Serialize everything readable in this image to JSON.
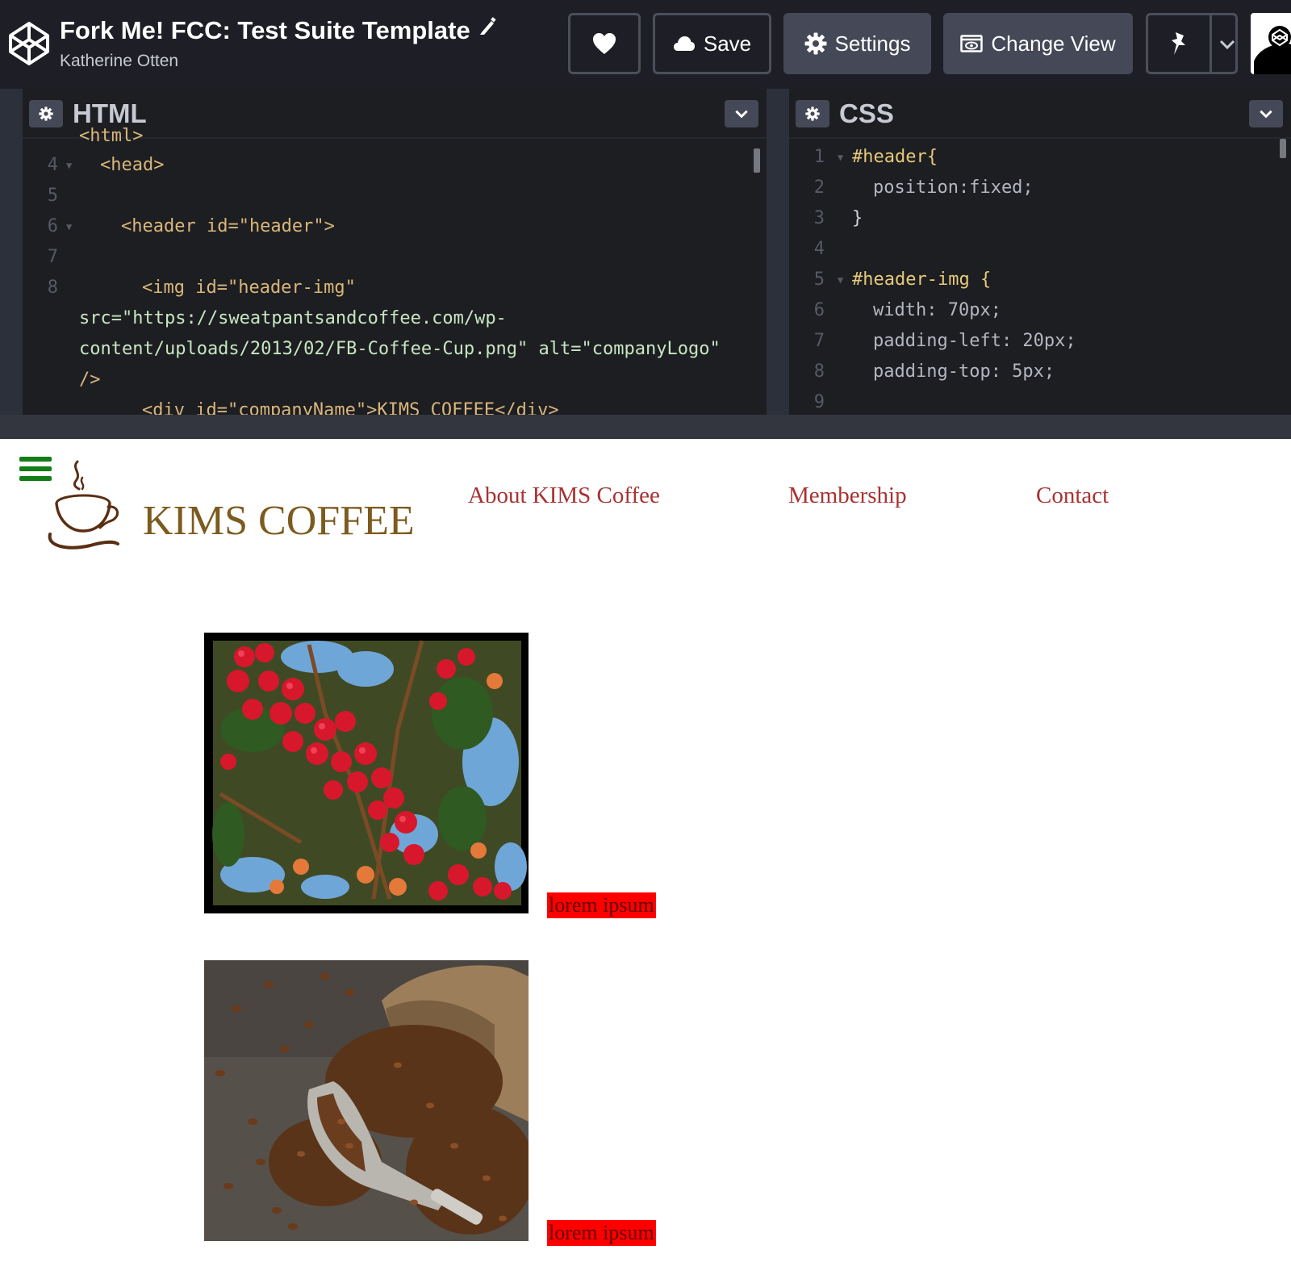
{
  "header": {
    "pen_title": "Fork Me! FCC: Test Suite Template",
    "author": "Katherine Otten",
    "save_label": "Save",
    "settings_label": "Settings",
    "change_view_label": "Change View"
  },
  "html_pane": {
    "title": "HTML",
    "lines": [
      {
        "num": "4",
        "text": "<head>"
      },
      {
        "num": "5",
        "text": ""
      },
      {
        "num": "6",
        "text": "<header id=\"header\">"
      },
      {
        "num": "7",
        "text": ""
      },
      {
        "num": "8",
        "text": "<img id=\"header-img\""
      },
      {
        "num": "",
        "text": "src=\"https://sweatpantsandcoffee.com/wp-"
      },
      {
        "num": "",
        "text": "content/uploads/2013/02/FB-Coffee-Cup.png\" alt=\"companyLogo\""
      },
      {
        "num": "",
        "text": "/>"
      }
    ]
  },
  "css_pane": {
    "title": "CSS",
    "lines": [
      {
        "num": "1",
        "text": "#header{"
      },
      {
        "num": "2",
        "text": "position:fixed;"
      },
      {
        "num": "3",
        "text": "}"
      },
      {
        "num": "4",
        "text": ""
      },
      {
        "num": "5",
        "text": "#header-img {"
      },
      {
        "num": "6",
        "text": "width: 70px;"
      },
      {
        "num": "7",
        "text": "padding-left: 20px;"
      },
      {
        "num": "8",
        "text": "padding-top: 5px;"
      },
      {
        "num": "9",
        "text": ""
      }
    ]
  },
  "preview": {
    "brand": "KIMS COFFEE",
    "nav": [
      "About KIMS Coffee",
      "Membership",
      "Contact"
    ],
    "captions": [
      "lorem ipsum",
      "lorem ipsum"
    ],
    "images": [
      "coffee-cherries-photo",
      "coffee-beans-scoop-photo"
    ]
  },
  "colors": {
    "topbar_bg": "#1e1f26",
    "editor_bg": "#1d1e22",
    "button_bg": "#444857",
    "brand_text": "#7c5b1e",
    "nav_link": "#a83232",
    "hamburger": "#137d16",
    "caption_bg": "#ff0000"
  }
}
